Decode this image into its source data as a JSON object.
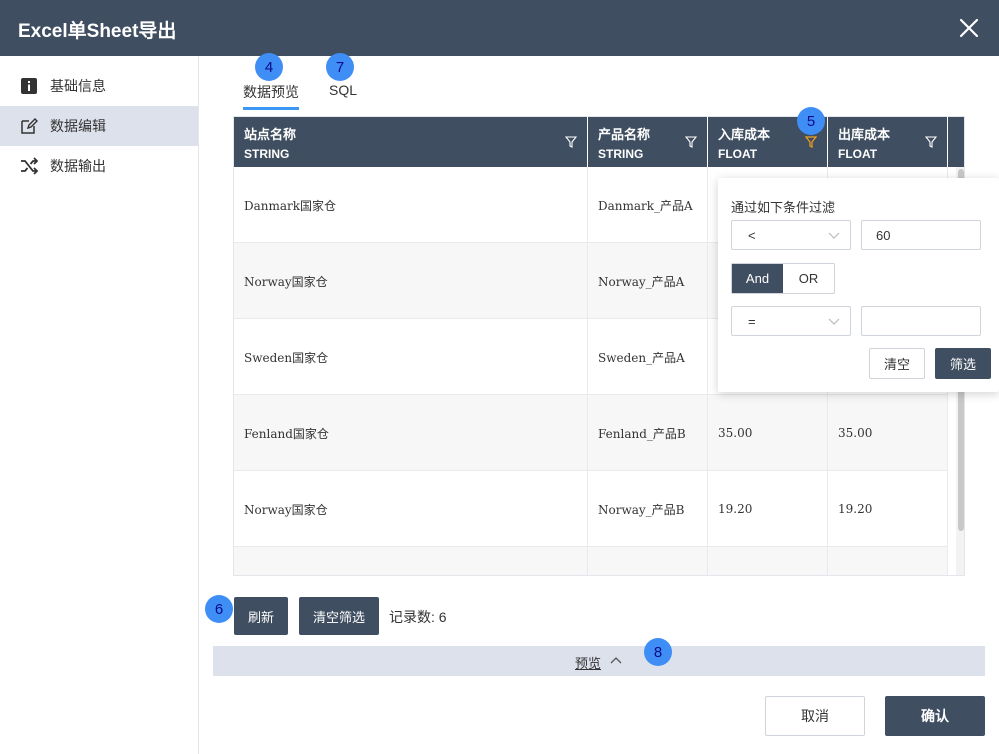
{
  "window": {
    "title": "Excel单Sheet导出",
    "close_icon": "close-icon"
  },
  "sidebar": {
    "items": [
      {
        "label": "基础信息",
        "icon": "info-icon",
        "active": false
      },
      {
        "label": "数据编辑",
        "icon": "edit-icon",
        "active": true
      },
      {
        "label": "数据输出",
        "icon": "shuffle-icon",
        "active": false
      }
    ]
  },
  "tabs": [
    {
      "label": "数据预览",
      "active": true
    },
    {
      "label": "SQL",
      "active": false
    }
  ],
  "badges": {
    "b4": "4",
    "b5": "5",
    "b6": "6",
    "b7": "7",
    "b8": "8"
  },
  "table": {
    "columns": [
      {
        "name": "站点名称",
        "type": "STRING"
      },
      {
        "name": "产品名称",
        "type": "STRING"
      },
      {
        "name": "入库成本",
        "type": "FLOAT",
        "filter_active": true
      },
      {
        "name": "出库成本",
        "type": "FLOAT"
      }
    ],
    "rows": [
      [
        "Danmark国家仓",
        "Danmark_产品A",
        "",
        ""
      ],
      [
        "Norway国家仓",
        "Norway_产品A",
        "",
        ""
      ],
      [
        "Sweden国家仓",
        "Sweden_产品A",
        "",
        ""
      ],
      [
        "Fenland国家仓",
        "Fenland_产品B",
        "35.00",
        "35.00"
      ],
      [
        "Norway国家仓",
        "Norway_产品B",
        "19.20",
        "19.20"
      ],
      [
        "",
        "",
        "",
        ""
      ]
    ]
  },
  "filter_popover": {
    "title": "通过如下条件过滤",
    "condition1": {
      "operator": "<",
      "value": "60"
    },
    "logic": {
      "and_label": "And",
      "or_label": "OR",
      "selected": "And"
    },
    "condition2": {
      "operator": "=",
      "value": ""
    },
    "clear_label": "清空",
    "apply_label": "筛选"
  },
  "actions": {
    "refresh_label": "刷新",
    "clear_filter_label": "清空筛选",
    "record_count_text": "记录数: 6"
  },
  "preview_bar": {
    "label": "预览"
  },
  "footer": {
    "cancel_label": "取消",
    "confirm_label": "确认"
  },
  "colors": {
    "header": "#3f4e60",
    "accent": "#3b96f4",
    "filter_active": "#f0a020",
    "sidebar_active": "#dde1eb"
  }
}
